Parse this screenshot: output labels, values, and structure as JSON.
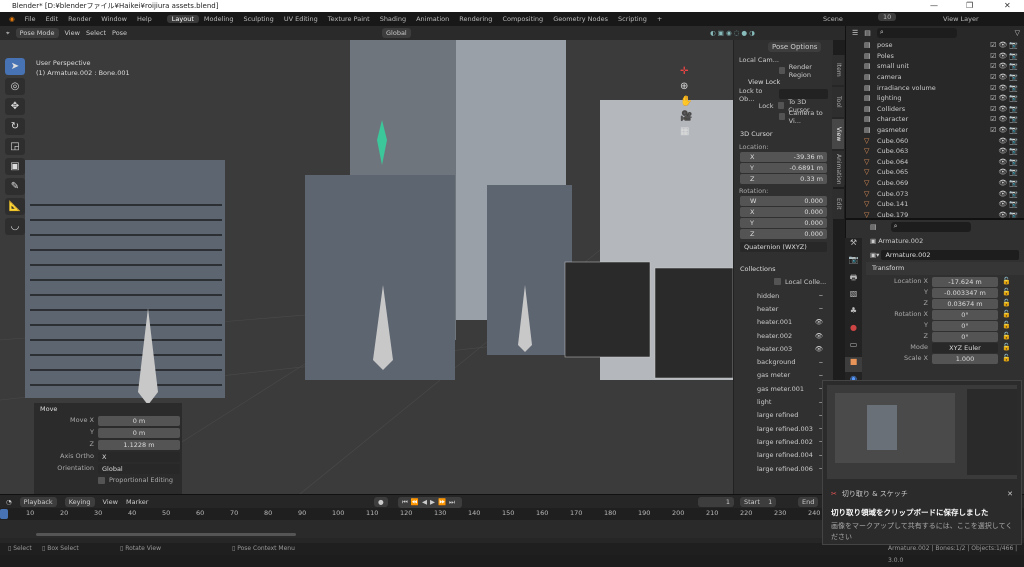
{
  "title": "Blender* [D:¥blenderファイル¥Haikei¥roijiura assets.blend]",
  "window_controls": [
    "—",
    "❐",
    "✕"
  ],
  "menu": [
    "File",
    "Edit",
    "Render",
    "Window",
    "Help"
  ],
  "workspaces": [
    "Layout",
    "Modeling",
    "Sculpting",
    "UV Editing",
    "Texture Paint",
    "Shading",
    "Animation",
    "Rendering",
    "Compositing",
    "Geometry Nodes",
    "Scripting",
    "+"
  ],
  "scene": "Scene",
  "scene_users": "10",
  "view_layer": "View Layer",
  "header": {
    "mode": "Pose Mode",
    "menus": [
      "View",
      "Select",
      "Pose"
    ],
    "orientation": "Global",
    "pose_options": "Pose Options"
  },
  "viewport": {
    "perspective": "User Perspective",
    "active": "(1) Armature.002 : Bone.001"
  },
  "move_panel": {
    "title": "Move",
    "move_x_label": "Move X",
    "x": "0 m",
    "y_label": "Y",
    "y": "0 m",
    "z_label": "Z",
    "z": "1.1228 m",
    "axis_ortho_label": "Axis Ortho",
    "axis_ortho": "X",
    "orientation_label": "Orientation",
    "orientation": "Global",
    "proportional": "Proportional Editing"
  },
  "npanel": {
    "local_cam": "Local Cam...",
    "render_region": "Render Region",
    "view_lock": "View Lock",
    "lock_to_obj": "Lock to Ob...",
    "lock": "Lock",
    "to_3d_cursor": "To 3D Cursor",
    "camera_to_view": "Camera to Vi...",
    "cursor_title": "3D Cursor",
    "location": "Location:",
    "loc": [
      {
        "l": "X",
        "v": "-39.36 m"
      },
      {
        "l": "Y",
        "v": "-0.6891 m"
      },
      {
        "l": "Z",
        "v": "0.33 m"
      }
    ],
    "rotation": "Rotation:",
    "rot": [
      {
        "l": "W",
        "v": "0.000"
      },
      {
        "l": "X",
        "v": "0.000"
      },
      {
        "l": "Y",
        "v": "0.000"
      },
      {
        "l": "Z",
        "v": "0.000"
      }
    ],
    "rot_mode": "Quaternion (WXYZ)",
    "collections_title": "Collections",
    "local_coll": "Local Colle...",
    "collections": [
      "hidden",
      "heater",
      "heater.001",
      "heater.002",
      "heater.003",
      "background",
      "gas meter",
      "gas meter.001",
      "light",
      "large refined",
      "large refined.003",
      "large refined.002",
      "large refined.004",
      "large refined.006"
    ],
    "tabs": [
      "Item",
      "Tool",
      "View",
      "Animation",
      "Edit"
    ]
  },
  "outliner": {
    "items": [
      "pose",
      "Poles",
      "small unit",
      "camera",
      "irradiance volume",
      "lighting",
      "Colliders",
      "character",
      "gasmeter",
      "Cube.060",
      "Cube.063",
      "Cube.064",
      "Cube.065",
      "Cube.069",
      "Cube.073",
      "Cube.141",
      "Cube.179"
    ]
  },
  "properties": {
    "object": "Armature.002",
    "data": "Armature.002",
    "transform": "Transform",
    "location_x_label": "Location X",
    "loc": [
      "-17.624 m",
      "-0.003347 m",
      "0.03674 m"
    ],
    "rotation_x_label": "Rotation X",
    "rot": [
      "0°",
      "0°",
      "0°"
    ],
    "mode_label": "Mode",
    "mode": "XYZ Euler",
    "scale_x_label": "Scale X",
    "scale_x": "1.000",
    "y": "Y",
    "z": "Z"
  },
  "timeline": {
    "menus": [
      "Playback",
      "Keying",
      "View",
      "Marker"
    ],
    "current": "1",
    "start_label": "Start",
    "start": "1",
    "end_label": "End",
    "ticks": [
      "10",
      "20",
      "30",
      "40",
      "50",
      "60",
      "70",
      "80",
      "90",
      "100",
      "110",
      "120",
      "130",
      "140",
      "150",
      "160",
      "170",
      "180",
      "190",
      "200",
      "210",
      "220",
      "230",
      "240"
    ]
  },
  "status": {
    "select": "Select",
    "box_select": "Box Select",
    "rotate": "Rotate View",
    "context": "Pose Context Menu",
    "info": "Armature.002 | Bones:1/2 | Objects:1/466 | 3.0.0"
  },
  "notification": {
    "app": "切り取り & スケッチ",
    "title": "切り取り領域をクリップボードに保存しました",
    "body": "画像をマークアップして共有するには、ここを選択してください",
    "close": "✕"
  }
}
